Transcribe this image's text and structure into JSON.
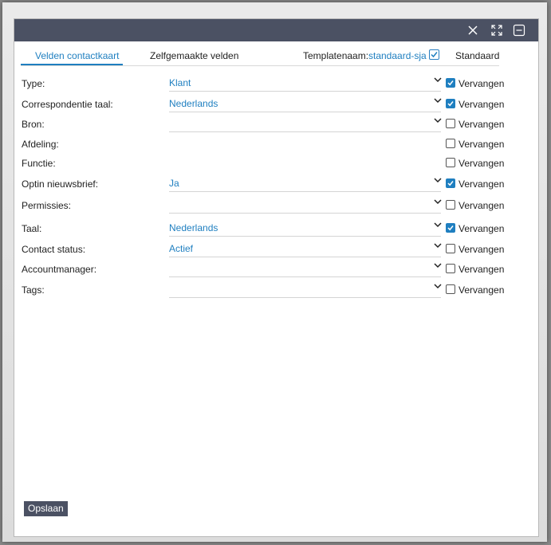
{
  "tabs": [
    {
      "label": "Velden contactkaart",
      "active": true
    },
    {
      "label": "Zelfgemaakte velden",
      "active": false
    }
  ],
  "template": {
    "label": "Templatenaam:",
    "value": "standaard-sja",
    "checked": true
  },
  "standard_label": "Standaard",
  "rows": [
    {
      "label": "Type:",
      "value": "Klant",
      "has_dropdown": true,
      "replace": true,
      "replace_label": "Vervangen"
    },
    {
      "label": "Correspondentie taal:",
      "value": "Nederlands",
      "has_dropdown": true,
      "replace": true,
      "replace_label": "Vervangen"
    },
    {
      "label": "Bron:",
      "value": "",
      "has_dropdown": true,
      "replace": false,
      "replace_label": "Vervangen"
    },
    {
      "label": "Afdeling:",
      "value": "",
      "has_dropdown": false,
      "replace": false,
      "replace_label": "Vervangen"
    },
    {
      "label": "Functie:",
      "value": "",
      "has_dropdown": false,
      "replace": false,
      "replace_label": "Vervangen"
    },
    {
      "label": "Optin nieuwsbrief:",
      "value": "Ja",
      "has_dropdown": true,
      "replace": true,
      "replace_label": "Vervangen"
    },
    {
      "label": "Permissies:",
      "value": "",
      "has_dropdown": true,
      "replace": false,
      "replace_label": "Vervangen"
    },
    {
      "label": "Taal:",
      "value": "Nederlands",
      "has_dropdown": true,
      "replace": true,
      "replace_label": "Vervangen"
    },
    {
      "label": "Contact status:",
      "value": "Actief",
      "has_dropdown": true,
      "replace": false,
      "replace_label": "Vervangen"
    },
    {
      "label": "Accountmanager:",
      "value": "",
      "has_dropdown": true,
      "replace": false,
      "replace_label": "Vervangen"
    },
    {
      "label": "Tags:",
      "value": "",
      "has_dropdown": true,
      "replace": false,
      "replace_label": "Vervangen"
    }
  ],
  "save_label": "Opslaan",
  "colors": {
    "titlebar": "#4b5163",
    "accent": "#1f7fc0"
  },
  "icons": {
    "close": "close-icon",
    "expand": "expand-icon",
    "minimize": "minimize-icon",
    "dropdown": "chevron-down-icon",
    "checkbox": "checkbox-icon"
  }
}
